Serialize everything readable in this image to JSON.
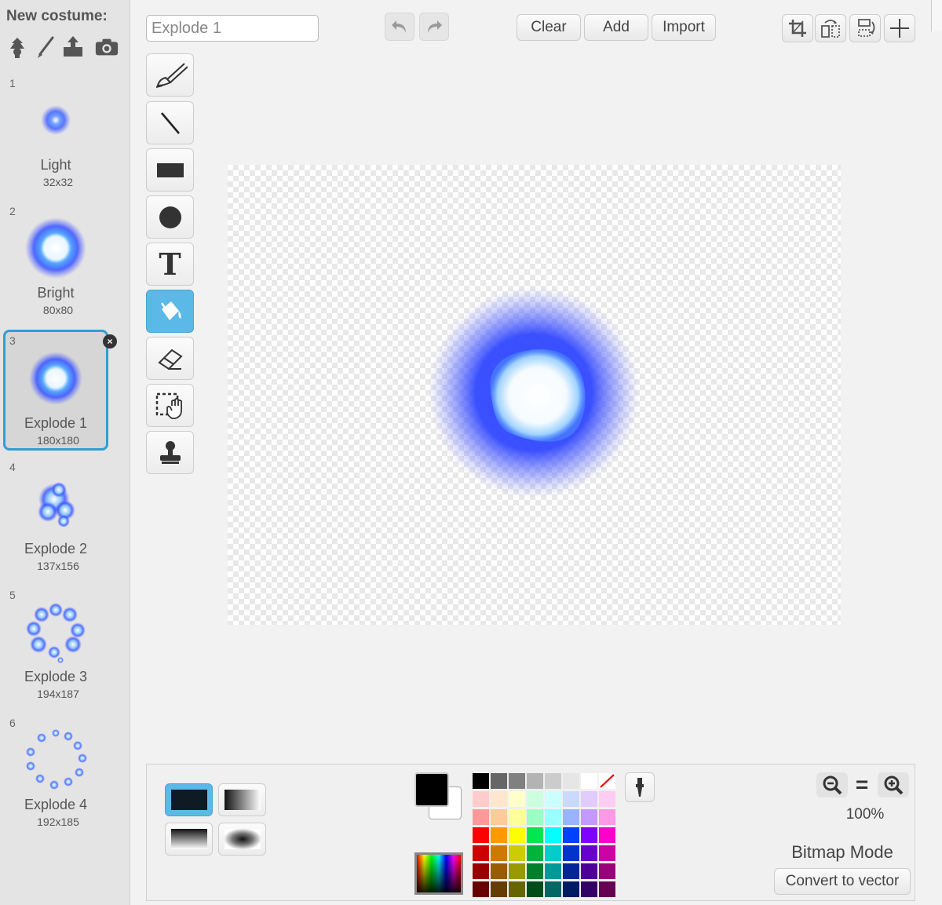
{
  "sidebar": {
    "new_costume_label": "New costume:",
    "new_costume_icons": [
      "sprite-library-icon",
      "paint-brush-icon",
      "upload-icon",
      "camera-icon"
    ],
    "costumes": [
      {
        "number": "1",
        "name": "Light",
        "size": "32x32",
        "selected": false
      },
      {
        "number": "2",
        "name": "Bright",
        "size": "80x80",
        "selected": false
      },
      {
        "number": "3",
        "name": "Explode 1",
        "size": "180x180",
        "selected": true
      },
      {
        "number": "4",
        "name": "Explode 2",
        "size": "137x156",
        "selected": false
      },
      {
        "number": "5",
        "name": "Explode 3",
        "size": "194x187",
        "selected": false
      },
      {
        "number": "6",
        "name": "Explode 4",
        "size": "192x185",
        "selected": false
      }
    ],
    "delete_glyph": "×"
  },
  "toolbar": {
    "costume_name_value": "Explode 1",
    "clear_label": "Clear",
    "add_label": "Add",
    "import_label": "Import"
  },
  "tools": [
    "brush-icon",
    "line-icon",
    "rectangle-icon",
    "ellipse-icon",
    "text-icon",
    "fill-bucket-icon",
    "eraser-icon",
    "select-icon",
    "stamp-icon"
  ],
  "active_tool": "fill-bucket-icon",
  "text_tool_glyph": "T",
  "bottom": {
    "zoom_level": "100%",
    "zoom_reset_glyph": "=",
    "mode_label": "Bitmap Mode",
    "convert_label": "Convert to vector",
    "primary_color": "#000000",
    "secondary_color": "#ffffff",
    "palette": [
      [
        "#000000",
        "#666666",
        "#808080",
        "#b3b3b3",
        "#cccccc",
        "#e6e6e6",
        "#ffffff",
        "none"
      ],
      [
        "#ffcccc",
        "#ffe6cc",
        "#ffffcc",
        "#ccffe0",
        "#ccffff",
        "#ccd9ff",
        "#e0ccff",
        "#ffccf2"
      ],
      [
        "#ff9999",
        "#ffcc99",
        "#ffff99",
        "#99ffc2",
        "#99ffff",
        "#99b3ff",
        "#c299ff",
        "#ff99e6"
      ],
      [
        "#ff0000",
        "#ff9900",
        "#ffff00",
        "#00e64d",
        "#00ffff",
        "#0040ff",
        "#8000ff",
        "#ff00cc"
      ],
      [
        "#cc0000",
        "#cc7a00",
        "#cccc00",
        "#00b33c",
        "#00cccc",
        "#0033cc",
        "#6600cc",
        "#cc00a3"
      ],
      [
        "#990000",
        "#995c00",
        "#999900",
        "#00802b",
        "#009999",
        "#002699",
        "#4d0099",
        "#99007a"
      ],
      [
        "#660000",
        "#663d00",
        "#666600",
        "#004d1a",
        "#006666",
        "#001a66",
        "#330066",
        "#660052"
      ]
    ],
    "accent_color": "#5ab9e6"
  }
}
